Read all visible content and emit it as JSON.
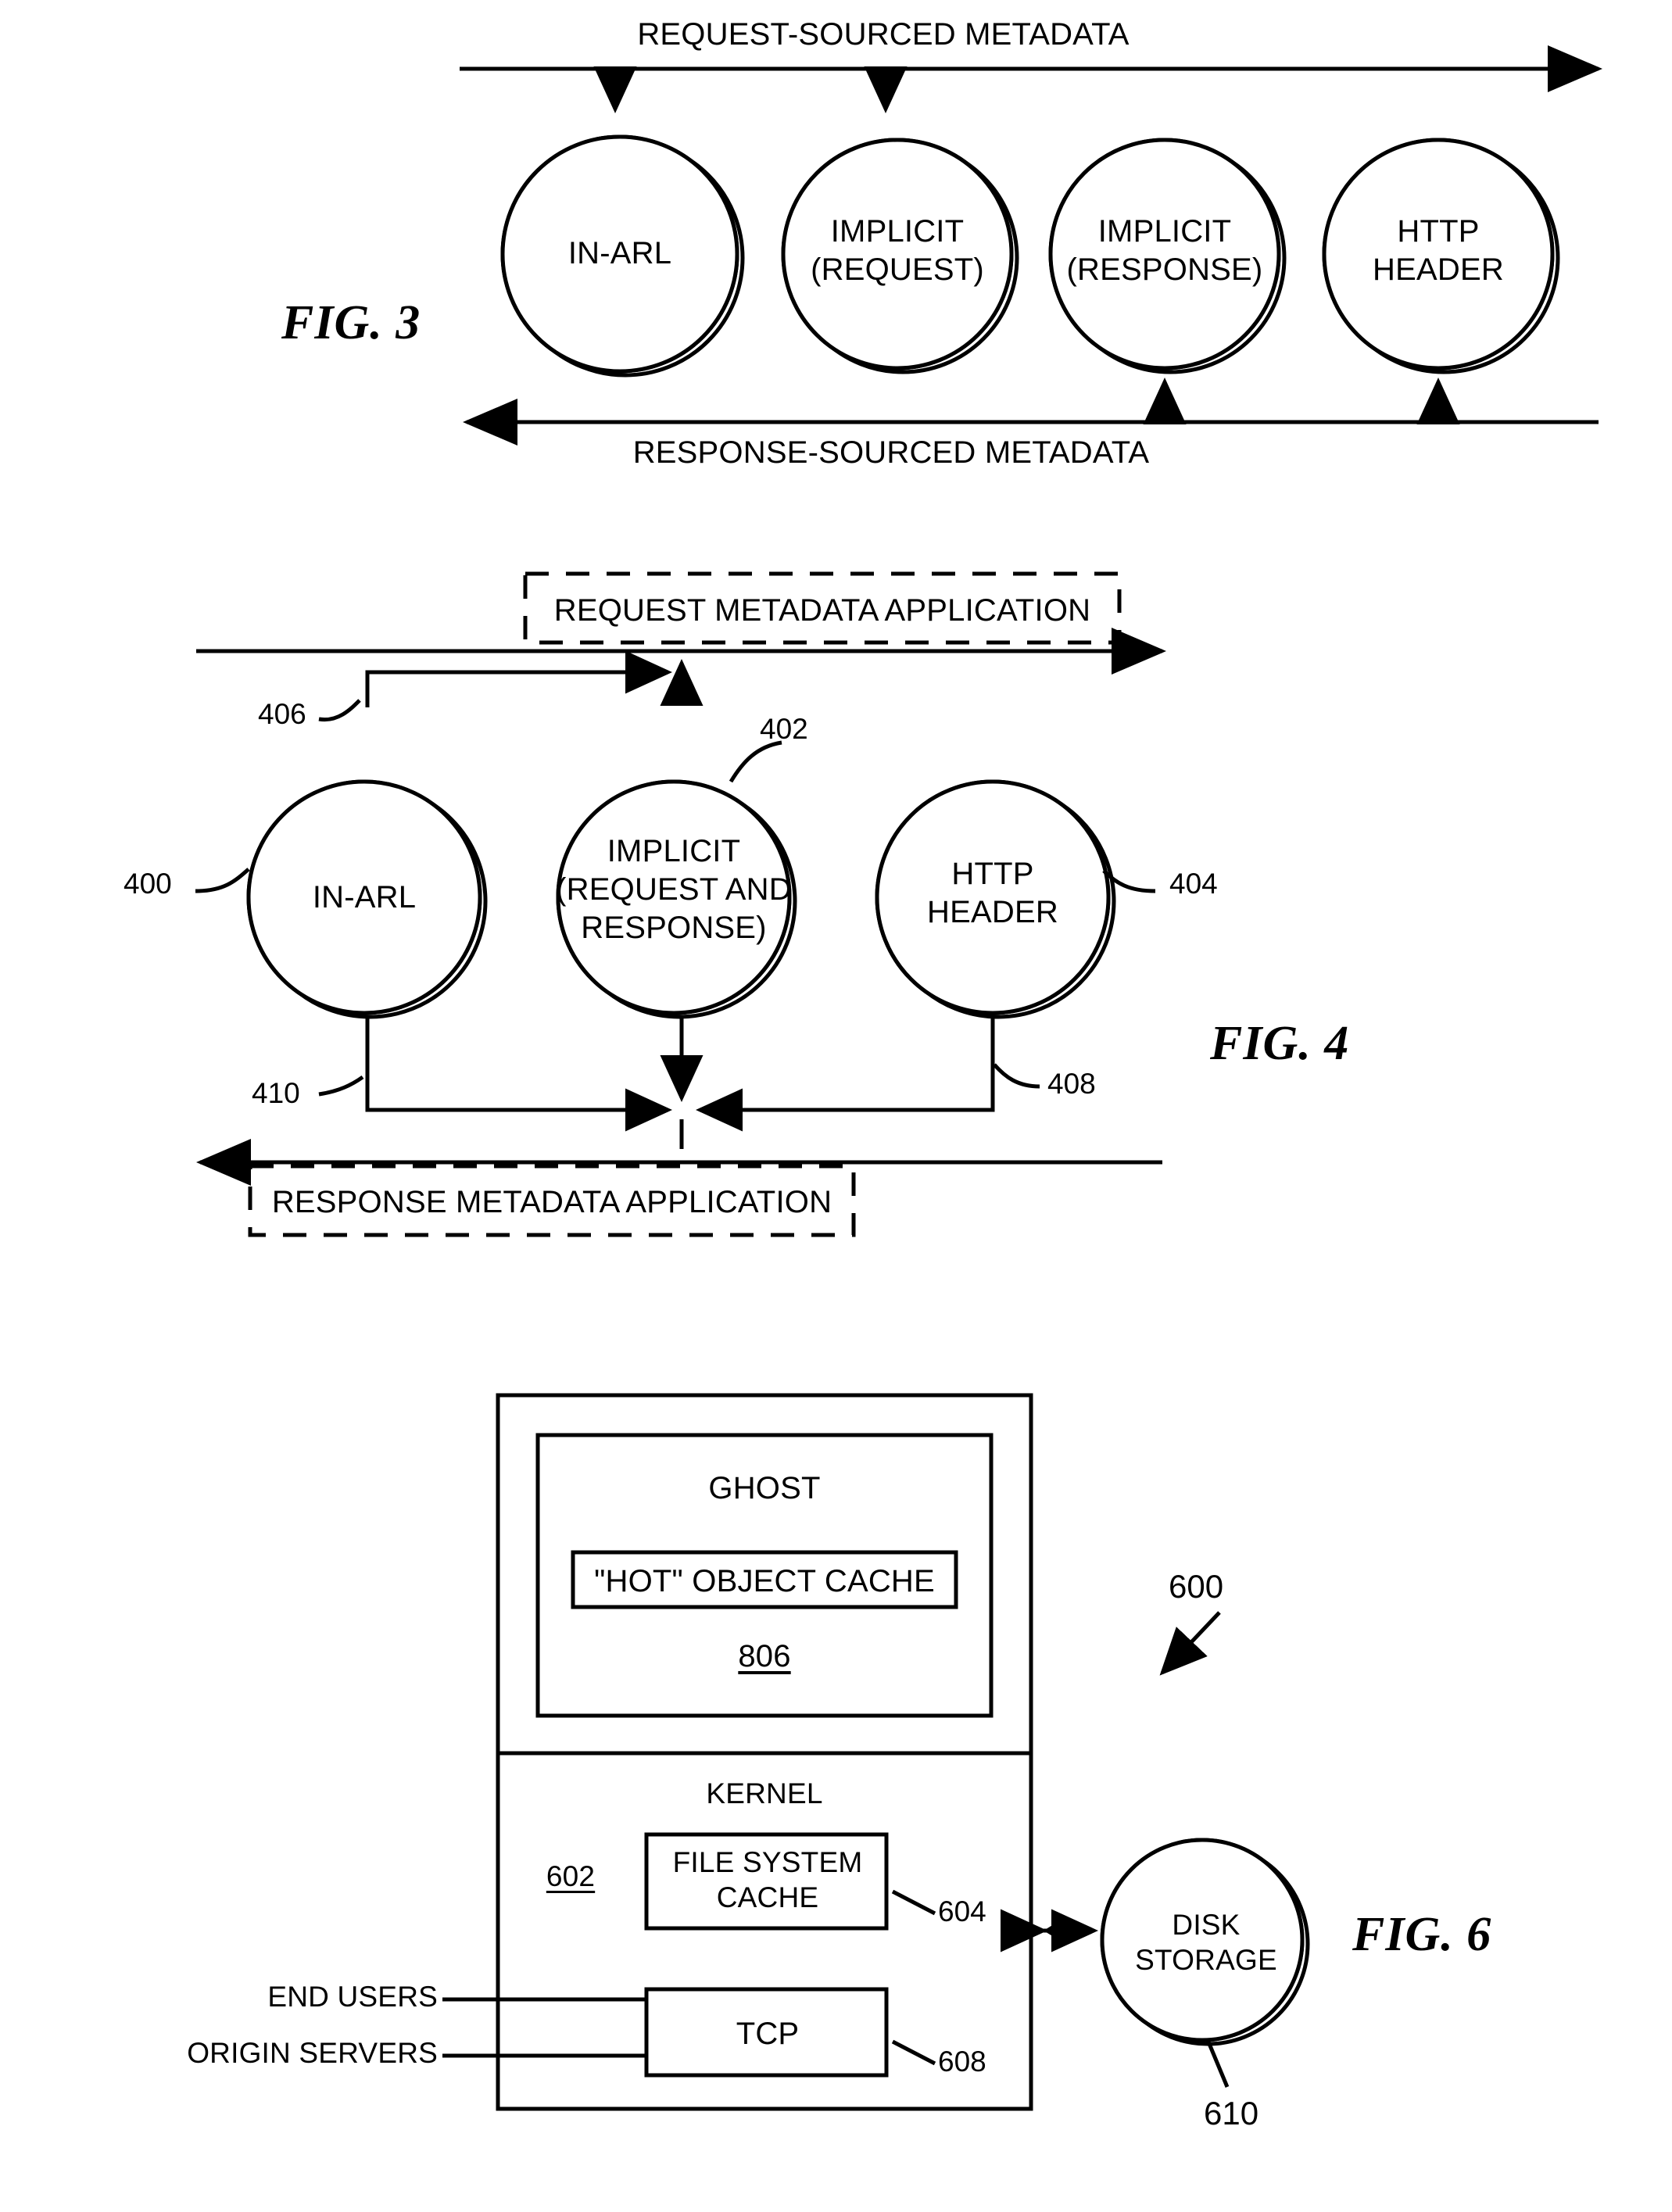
{
  "figures": {
    "fig3": {
      "label": "FIG. 3",
      "top_arrow_label": "REQUEST-SOURCED METADATA",
      "bottom_arrow_label": "RESPONSE-SOURCED METADATA",
      "nodes": [
        {
          "id": "in-arl",
          "lines": [
            "IN-ARL"
          ]
        },
        {
          "id": "implicit-request",
          "lines": [
            "IMPLICIT",
            "(REQUEST)"
          ]
        },
        {
          "id": "implicit-response",
          "lines": [
            "IMPLICIT",
            "(RESPONSE)"
          ]
        },
        {
          "id": "http-header",
          "lines": [
            "HTTP",
            "HEADER"
          ]
        }
      ]
    },
    "fig4": {
      "label": "FIG. 4",
      "top_box_label": "REQUEST METADATA APPLICATION",
      "bottom_box_label": "RESPONSE METADATA APPLICATION",
      "nodes": [
        {
          "id": "in-arl",
          "lines": [
            "IN-ARL"
          ],
          "ref": "400"
        },
        {
          "id": "implicit",
          "lines": [
            "IMPLICIT",
            "(REQUEST AND",
            "RESPONSE)"
          ],
          "ref": "402"
        },
        {
          "id": "http-header",
          "lines": [
            "HTTP",
            "HEADER"
          ],
          "ref": "404"
        }
      ],
      "refs": {
        "r400": "400",
        "r402": "402",
        "r404": "404",
        "r406": "406",
        "r408": "408",
        "r410": "410"
      }
    },
    "fig6": {
      "label": "FIG. 6",
      "ref_system": "600",
      "ghost_title": "GHOST",
      "hot_object_cache": "\"HOT\" OBJECT CACHE",
      "hot_object_cache_ref": "806",
      "kernel_title": "KERNEL",
      "kernel_ref": "602",
      "file_system_cache": [
        "FILE SYSTEM",
        "CACHE"
      ],
      "file_system_cache_ref": "604",
      "tcp": "TCP",
      "tcp_ref": "608",
      "end_users": "END USERS",
      "origin_servers": "ORIGIN SERVERS",
      "disk_storage": [
        "DISK",
        "STORAGE"
      ],
      "disk_storage_ref": "610"
    }
  },
  "colors": {
    "ink": "#000000",
    "paper": "#ffffff"
  }
}
